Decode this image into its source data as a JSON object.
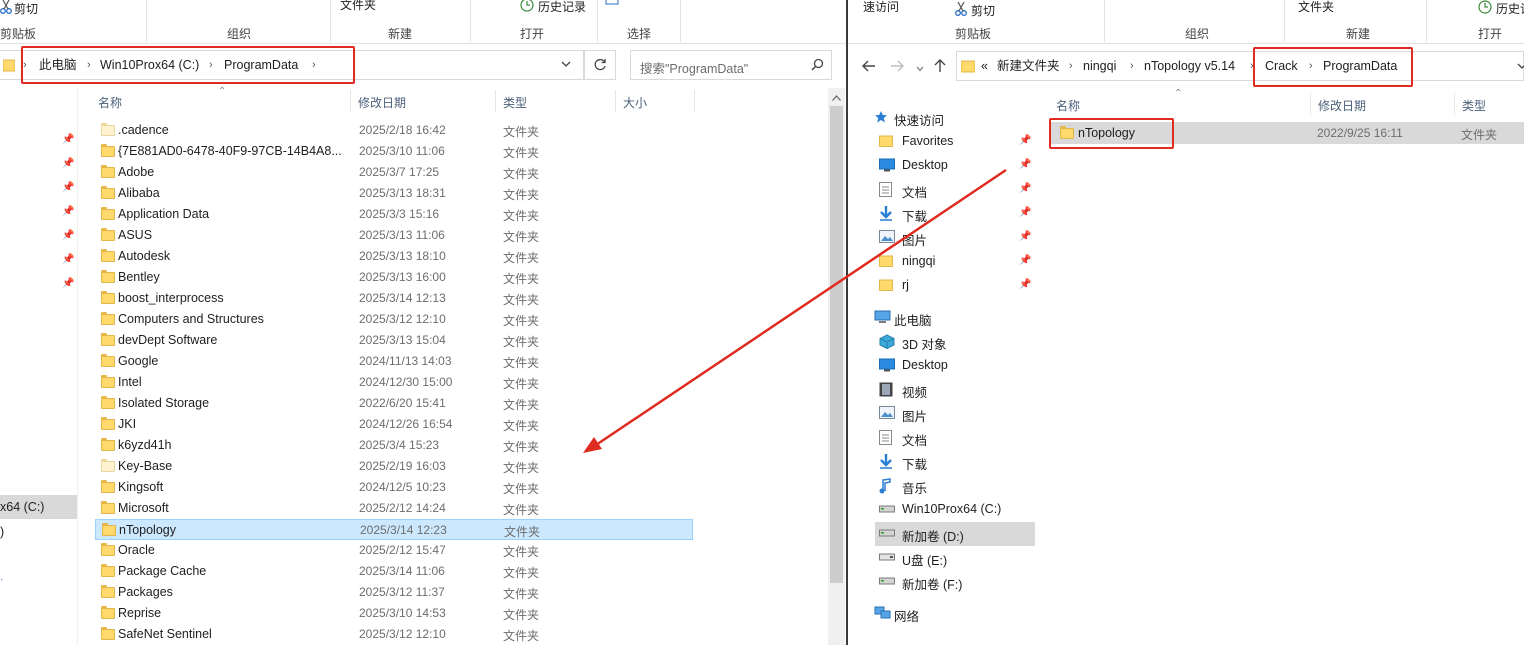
{
  "left": {
    "ribbon": {
      "cut": "剪切",
      "folder": "文件夹",
      "history": "历史记录",
      "clipboard_group": "剪贴板",
      "organize_group": "组织",
      "new_group": "新建",
      "open_group": "打开",
      "select_group": "选择"
    },
    "breadcrumb": [
      "此电脑",
      "Win10Prox64 (C:)",
      "ProgramData"
    ],
    "search_placeholder": "搜索\"ProgramData\"",
    "columns": {
      "name": "名称",
      "date": "修改日期",
      "type": "类型",
      "size": "大小"
    },
    "nav": {
      "drive_c": "x64 (C:)",
      "paren": ")"
    },
    "files": [
      {
        "name": ".cadence",
        "date": "2025/2/18 16:42",
        "type": "文件夹",
        "pale": true
      },
      {
        "name": "{7E881AD0-6478-40F9-97CB-14B4A8...",
        "date": "2025/3/10 11:06",
        "type": "文件夹"
      },
      {
        "name": "Adobe",
        "date": "2025/3/7 17:25",
        "type": "文件夹"
      },
      {
        "name": "Alibaba",
        "date": "2025/3/13 18:31",
        "type": "文件夹"
      },
      {
        "name": "Application Data",
        "date": "2025/3/3 15:16",
        "type": "文件夹"
      },
      {
        "name": "ASUS",
        "date": "2025/3/13 11:06",
        "type": "文件夹"
      },
      {
        "name": "Autodesk",
        "date": "2025/3/13 18:10",
        "type": "文件夹"
      },
      {
        "name": "Bentley",
        "date": "2025/3/13 16:00",
        "type": "文件夹"
      },
      {
        "name": "boost_interprocess",
        "date": "2025/3/14 12:13",
        "type": "文件夹"
      },
      {
        "name": "Computers and Structures",
        "date": "2025/3/12 12:10",
        "type": "文件夹"
      },
      {
        "name": "devDept Software",
        "date": "2025/3/13 15:04",
        "type": "文件夹"
      },
      {
        "name": "Google",
        "date": "2024/11/13 14:03",
        "type": "文件夹"
      },
      {
        "name": "Intel",
        "date": "2024/12/30 15:00",
        "type": "文件夹"
      },
      {
        "name": "Isolated Storage",
        "date": "2022/6/20 15:41",
        "type": "文件夹"
      },
      {
        "name": "JKI",
        "date": "2024/12/26 16:54",
        "type": "文件夹"
      },
      {
        "name": "k6yzd41h",
        "date": "2025/3/4 15:23",
        "type": "文件夹"
      },
      {
        "name": "Key-Base",
        "date": "2025/2/19 16:03",
        "type": "文件夹",
        "pale": true
      },
      {
        "name": "Kingsoft",
        "date": "2024/12/5 10:23",
        "type": "文件夹"
      },
      {
        "name": "Microsoft",
        "date": "2025/2/12 14:24",
        "type": "文件夹"
      },
      {
        "name": "nTopology",
        "date": "2025/3/14 12:23",
        "type": "文件夹",
        "selected": true
      },
      {
        "name": "Oracle",
        "date": "2025/2/12 15:47",
        "type": "文件夹"
      },
      {
        "name": "Package Cache",
        "date": "2025/3/14 11:06",
        "type": "文件夹"
      },
      {
        "name": "Packages",
        "date": "2025/3/12 11:37",
        "type": "文件夹"
      },
      {
        "name": "Reprise",
        "date": "2025/3/10 14:53",
        "type": "文件夹"
      },
      {
        "name": "SafeNet Sentinel",
        "date": "2025/3/12 12:10",
        "type": "文件夹"
      }
    ]
  },
  "right": {
    "ribbon": {
      "quick_access": "速访问",
      "cut": "剪切",
      "folder": "文件夹",
      "history": "历史记",
      "clipboard_group": "剪贴板",
      "organize_group": "组织",
      "new_group": "新建",
      "open_group": "打开"
    },
    "breadcrumb_prefix": "«",
    "breadcrumb": [
      "新建文件夹",
      "ningqi",
      "nTopology v5.14",
      "Crack",
      "ProgramData"
    ],
    "columns": {
      "name": "名称",
      "date": "修改日期",
      "type": "类型"
    },
    "nav": [
      {
        "label": "快速访问",
        "icon": "star-icon",
        "pinned": false
      },
      {
        "label": "Favorites",
        "icon": "folder-icon",
        "pinned": true
      },
      {
        "label": "Desktop",
        "icon": "desktop-icon",
        "pinned": true
      },
      {
        "label": "文档",
        "icon": "document-icon",
        "pinned": true
      },
      {
        "label": "下载",
        "icon": "download-icon",
        "pinned": true
      },
      {
        "label": "图片",
        "icon": "picture-icon",
        "pinned": true
      },
      {
        "label": "ningqi",
        "icon": "folder-icon",
        "pinned": true
      },
      {
        "label": "rj",
        "icon": "folder-icon",
        "pinned": true
      },
      {
        "label": "此电脑",
        "icon": "computer-icon",
        "pinned": false
      },
      {
        "label": "3D 对象",
        "icon": "cube-icon",
        "pinned": false
      },
      {
        "label": "Desktop",
        "icon": "desktop-icon",
        "pinned": false
      },
      {
        "label": "视频",
        "icon": "video-icon",
        "pinned": false
      },
      {
        "label": "图片",
        "icon": "picture-icon",
        "pinned": false
      },
      {
        "label": "文档",
        "icon": "document-icon",
        "pinned": false
      },
      {
        "label": "下载",
        "icon": "download-icon",
        "pinned": false
      },
      {
        "label": "音乐",
        "icon": "music-icon",
        "pinned": false
      },
      {
        "label": "Win10Prox64 (C:)",
        "icon": "drive-icon",
        "pinned": false
      },
      {
        "label": "新加卷 (D:)",
        "icon": "drive-icon",
        "pinned": false,
        "selected": true
      },
      {
        "label": "U盘 (E:)",
        "icon": "usb-drive-icon",
        "pinned": false
      },
      {
        "label": "新加卷 (F:)",
        "icon": "drive-icon",
        "pinned": false
      },
      {
        "label": "网络",
        "icon": "network-icon",
        "pinned": false
      }
    ],
    "files": [
      {
        "name": "nTopology",
        "date": "2022/9/25 16:11",
        "type": "文件夹"
      }
    ]
  },
  "colors": {
    "highlight_red": "#e02c20",
    "selection_blue": "#cce8ff",
    "folder_yellow": "#ffd96b"
  }
}
